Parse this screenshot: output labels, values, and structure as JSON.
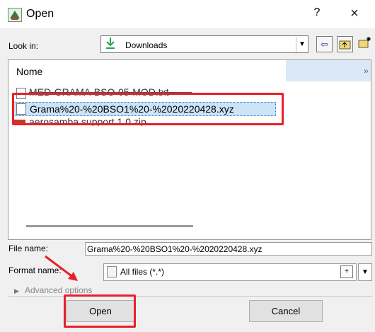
{
  "window": {
    "title": "Open",
    "help": "?",
    "close": "×"
  },
  "look_in": {
    "label": "Look in:",
    "value": "Downloads"
  },
  "file_list": {
    "column_header": "Nome",
    "more": "»",
    "files": [
      {
        "name": "MED-GRAMA-BSO-05-MOD.txt"
      },
      {
        "name": "Grama%20-%20BSO1%20-%2020220428.xyz",
        "selected": true
      },
      {
        "name": "aerosamba support 1.0.zip"
      }
    ]
  },
  "file_name": {
    "label": "File name:",
    "value": "Grama%20-%20BSO1%20-%2020220428.xyz"
  },
  "format": {
    "label": "Format name:",
    "value": "All files (*.*)"
  },
  "advanced": {
    "label": "Advanced options"
  },
  "buttons": {
    "open": "Open",
    "cancel": "Cancel"
  },
  "colors": {
    "annotation": "#e8202a",
    "selection": "#cce4f7",
    "dialog_bg": "#f0f0f0"
  }
}
